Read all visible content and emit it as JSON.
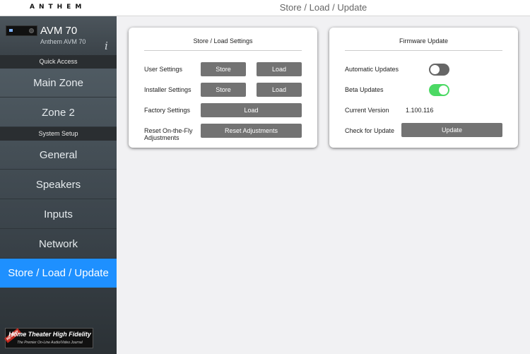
{
  "header": {
    "logo": "ANTHEM",
    "title": "Store / Load / Update"
  },
  "sidebar": {
    "device_name": "AVM 70",
    "device_model": "Anthem AVM 70",
    "info_icon": "i",
    "sections": [
      {
        "header": "Quick Access",
        "items": [
          "Main Zone",
          "Zone 2"
        ]
      },
      {
        "header": "System Setup",
        "items": [
          "General",
          "Speakers",
          "Inputs",
          "Network",
          "Store / Load / Update"
        ]
      }
    ],
    "active_item": "Store / Load / Update"
  },
  "badge": {
    "tag": "REVIEW",
    "main": "Home Theater High Fidelity",
    "sub": "The Premier On-Line Audio/Video Journal"
  },
  "store_load": {
    "title": "Store / Load Settings",
    "user_settings": {
      "label": "User Settings",
      "store": "Store",
      "load": "Load"
    },
    "installer_settings": {
      "label": "Installer Settings",
      "store": "Store",
      "load": "Load"
    },
    "factory_settings": {
      "label": "Factory Settings",
      "load": "Load"
    },
    "reset_fly": {
      "label": "Reset On-the-Fly Adjustments",
      "button": "Reset Adjustments"
    }
  },
  "firmware": {
    "title": "Firmware Update",
    "automatic_updates": {
      "label": "Automatic Updates",
      "enabled": false
    },
    "beta_updates": {
      "label": "Beta Updates",
      "enabled": true
    },
    "current_version": {
      "label": "Current Version",
      "value": "1.100.116"
    },
    "check_update": {
      "label": "Check for Update",
      "button": "Update"
    }
  },
  "colors": {
    "accent": "#1e90ff",
    "toggle_on": "#4cd964",
    "toggle_off": "#666666",
    "button": "#737373"
  }
}
